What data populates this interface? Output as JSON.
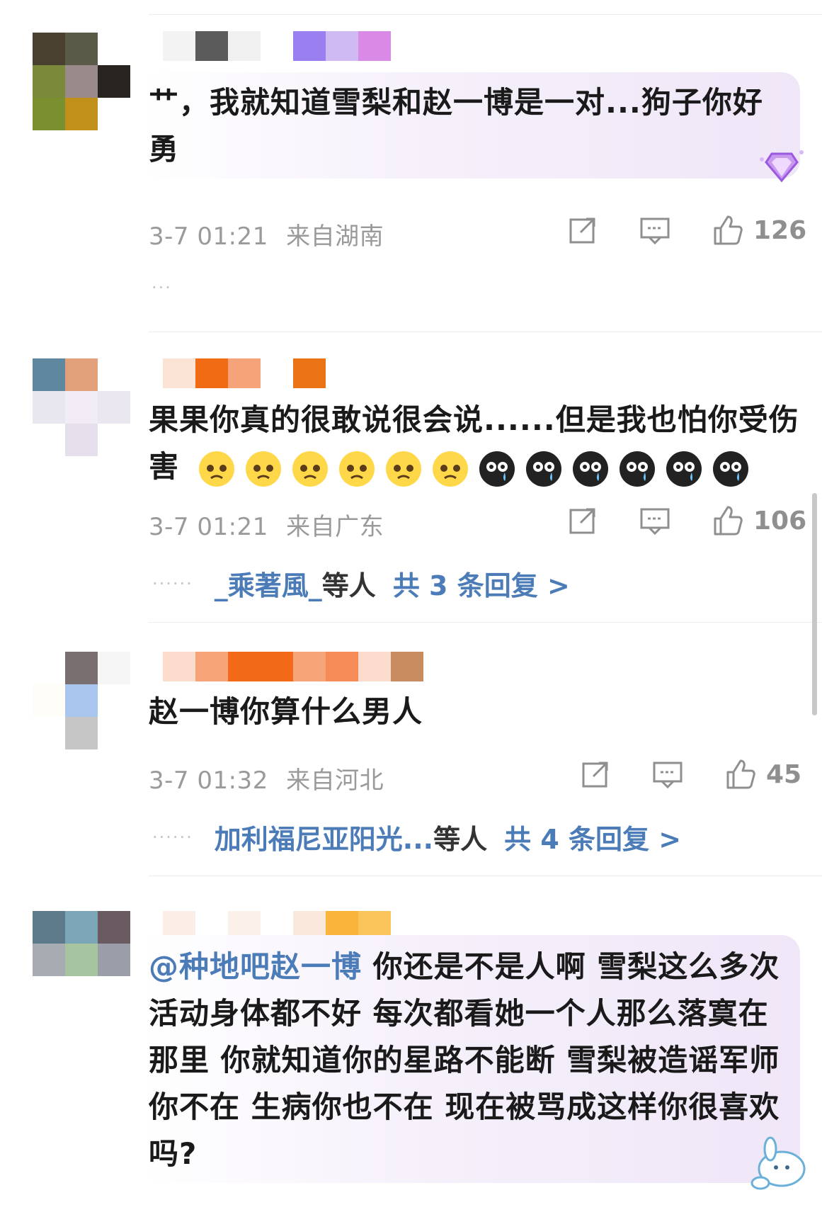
{
  "comments": [
    {
      "text": "艹，我就知道雪梨和赵一博是一对...狗子你好勇",
      "time": "3-7 01:21",
      "location": "来自湖南",
      "likes": "126",
      "more": "···"
    },
    {
      "text": "果果你真的很敢说很会说......但是我也怕你受伤害",
      "time": "3-7 01:21",
      "location": "来自广东",
      "likes": "106",
      "reply_names": "_乘著風_",
      "reply_suffix": "等人",
      "reply_total": "共 3 条回复 >"
    },
    {
      "text": "赵一博你算什么男人",
      "time": "3-7 01:32",
      "location": "来自河北",
      "likes": "45",
      "reply_names": "加利福尼亚阳光...",
      "reply_suffix": "等人",
      "reply_total": "共 4 条回复 >"
    },
    {
      "mention": "@种地吧赵一博",
      "text": " 你还是不是人啊 雪梨这么多次活动身体都不好 每次都看她一个人那么落寞在那里 你就知道你的星路不能断 雪梨被造谣军师你不在 生病你也不在 现在被骂成这样你很喜欢吗?"
    }
  ],
  "icons": {
    "share": "share-icon",
    "comment": "comment-icon",
    "like": "thumbs-up-icon",
    "emoji_pleading": "pleading-face-emoji",
    "emoji_crying": "crying-face-emoji"
  },
  "colors": {
    "link_blue": "#4c7cb8",
    "meta_gray": "#9a9a9a"
  }
}
